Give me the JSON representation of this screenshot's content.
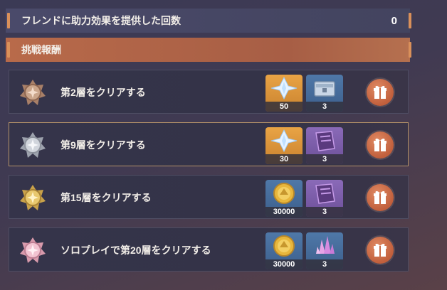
{
  "friend_bar": {
    "label": "フレンドに助力効果を提供した回数",
    "count": "0"
  },
  "reward_header": {
    "label": "挑戦報酬"
  },
  "rewards": [
    {
      "task": "第2層をクリアする",
      "medal": "bronze-medal-icon",
      "items": [
        {
          "icon": "crystal-icon",
          "qty": "50"
        },
        {
          "icon": "chest-icon",
          "qty": "3"
        }
      ]
    },
    {
      "task": "第9層をクリアする",
      "medal": "silver-medal-icon",
      "items": [
        {
          "icon": "crystal-icon",
          "qty": "30"
        },
        {
          "icon": "book-icon",
          "qty": "3"
        }
      ]
    },
    {
      "task": "第15層をクリアする",
      "medal": "gold-medal-icon",
      "items": [
        {
          "icon": "coin-icon",
          "qty": "30000"
        },
        {
          "icon": "book-icon",
          "qty": "3"
        }
      ]
    },
    {
      "task": "ソロプレイで第20層をクリアする",
      "medal": "pink-medal-icon",
      "items": [
        {
          "icon": "coin-icon",
          "qty": "30000"
        },
        {
          "icon": "pink-crystal-icon",
          "qty": "3"
        }
      ]
    }
  ],
  "colors": {
    "accent": "#c15f3c",
    "header": "#b86a4a",
    "selected_border": "#b49268"
  }
}
